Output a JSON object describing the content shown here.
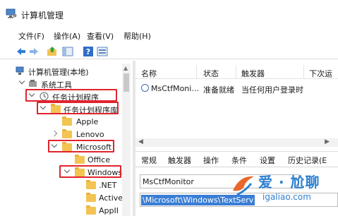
{
  "window": {
    "title": "计算机管理"
  },
  "menu": [
    "文件(F)",
    "操作(A)",
    "查看(V)",
    "帮助(H)"
  ],
  "tree": {
    "root": "计算机管理(本地)",
    "system_tools": "系统工具",
    "task_scheduler": "任务计划程序",
    "task_library": "任务计划程序库",
    "apple": "Apple",
    "lenovo": "Lenovo",
    "microsoft": "Microsoft",
    "office": "Office",
    "windows": "Windows",
    "net": ".NET",
    "active": "Active",
    "appli": "AppII"
  },
  "list": {
    "columns": [
      "名称",
      "状态",
      "触发器",
      "下次运"
    ],
    "rows": [
      {
        "name": "MsCtfMoni...",
        "status": "准备就绪",
        "trigger": "当任何用户登录时"
      }
    ]
  },
  "detail": {
    "tabs": [
      "常规",
      "触发器",
      "操作",
      "条件",
      "设置",
      "历史记录(E"
    ],
    "name_value": "MsCtfMonitor",
    "path_value": "\\Microsoft\\Windows\\TextServ"
  },
  "watermark": {
    "text": "爱 · 尬聊",
    "url": "igaliao.com"
  },
  "colors": {
    "highlight_box": "#e0242e",
    "selection": "#3a7ed6",
    "folder": "#f3c451",
    "watermark": "#2b7fd1"
  }
}
